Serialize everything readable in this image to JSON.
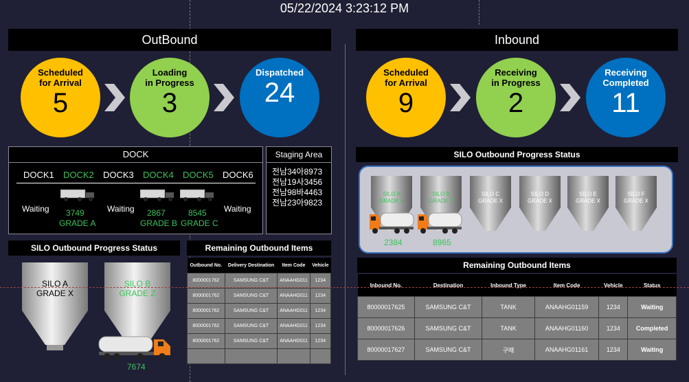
{
  "datetime": "05/22/2024 3:23:12 PM",
  "outbound": {
    "title": "OutBound",
    "stages": [
      {
        "label_line1": "Scheduled",
        "label_line2": "for Arrival",
        "count": "5",
        "color": "#ffc000"
      },
      {
        "label_line1": "Loading",
        "label_line2": "in Progress",
        "count": "3",
        "color": "#92d050"
      },
      {
        "label_line1": "Dispatched",
        "label_line2": "",
        "count": "24",
        "color": "#0070c0"
      }
    ],
    "dock": {
      "title": "DOCK",
      "docks": [
        "DOCK1",
        "DOCK2",
        "DOCK3",
        "DOCK4",
        "DOCK5",
        "DOCK6"
      ],
      "waiting": [
        "Waiting",
        "Waiting",
        "Waiting"
      ],
      "loads": [
        {
          "number": "3749",
          "grade": "GRADE A"
        },
        {
          "number": "2867",
          "grade": "GRADE B"
        },
        {
          "number": "8545",
          "grade": "GRADE C"
        }
      ]
    },
    "staging": {
      "title": "Staging Area",
      "plates": [
        "전남34아8973",
        "전남19사3456",
        "전남98바4463",
        "전남23아9823"
      ]
    },
    "silo_status": {
      "title": "SILO Outbound Progress Status",
      "silos": [
        {
          "name": "SILO A",
          "grade": "GRADE X"
        },
        {
          "name": "SILO B",
          "grade": "GRADE Z"
        }
      ],
      "truck_number": "7674"
    },
    "remaining": {
      "title": "Remaining Outbound Items",
      "columns": [
        "Outbound No.",
        "Delivery Destination",
        "Item Code",
        "Vehicle"
      ],
      "rows": [
        [
          "8000001762",
          "SAMSUNG C&T",
          "ANAAHG011",
          "1234"
        ],
        [
          "8000001762",
          "SAMSUNG C&T",
          "ANAAHG011",
          "1234"
        ],
        [
          "8000001762",
          "SAMSUNG C&T",
          "ANAAHG011",
          "1234"
        ],
        [
          "8000001762",
          "SAMSUNG C&T",
          "ANAAHG011",
          "1234"
        ],
        [
          "8000001762",
          "SAMSUNG C&T",
          "ANAAHG011",
          "1234"
        ],
        [
          "",
          "",
          "",
          ""
        ]
      ]
    }
  },
  "inbound": {
    "title": "Inbound",
    "stages": [
      {
        "label_line1": "Scheduled",
        "label_line2": "for Arrival",
        "count": "9",
        "color": "#ffc000"
      },
      {
        "label_line1": "Receiving",
        "label_line2": "in Progress",
        "count": "2",
        "color": "#92d050"
      },
      {
        "label_line1": "Receiving",
        "label_line2": "Completed",
        "count": "11",
        "color": "#0070c0"
      }
    ],
    "silo_status": {
      "title": "SILO Outbound Progress Status",
      "silos": [
        {
          "name": "SILO A",
          "grade": "GRADE X",
          "active": true
        },
        {
          "name": "SILO B",
          "grade": "GRADE X",
          "active": true
        },
        {
          "name": "SILO C",
          "grade": "GRADE X",
          "active": false
        },
        {
          "name": "SILO D",
          "grade": "GRADE X",
          "active": false
        },
        {
          "name": "SILO E",
          "grade": "GRADE X",
          "active": false
        },
        {
          "name": "SILO F",
          "grade": "GRADE X",
          "active": false
        }
      ],
      "truck_numbers": [
        "2384",
        "8965"
      ]
    },
    "remaining": {
      "title": "Remaining Outbound Items",
      "columns": [
        "Inbound No.",
        "Destination",
        "Inbound Type",
        "Item Code",
        "Vehicle",
        "Status"
      ],
      "rows": [
        [
          "80000017625",
          "SAMSUNG C&T",
          "TANK",
          "ANAAHG01159",
          "1234",
          "Waiting"
        ],
        [
          "80000017626",
          "SAMSUNG C&T",
          "TANK",
          "ANAAHG01160",
          "1234",
          "Completed"
        ],
        [
          "80000017627",
          "SAMSUNG C&T",
          "구매",
          "ANAAHG01161",
          "1234",
          "Waiting"
        ]
      ]
    }
  }
}
